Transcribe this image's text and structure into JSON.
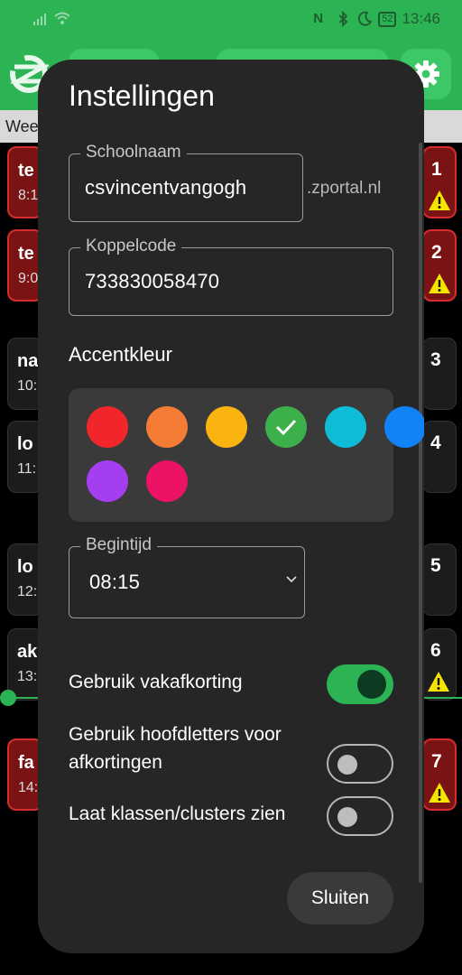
{
  "status_bar": {
    "time": "13:46",
    "battery": "52",
    "icons": [
      "signal-icon",
      "wifi-icon",
      "nfc-icon",
      "bluetooth-icon",
      "moon-icon",
      "battery-icon"
    ]
  },
  "appbar": {
    "week_label": "Wee"
  },
  "background_lessons": [
    {
      "title": "te",
      "time": "8:1",
      "num": "1",
      "warning": true,
      "red": true
    },
    {
      "title": "te",
      "time": "9:0",
      "num": "2",
      "warning": true,
      "red": true
    },
    {
      "title": "na",
      "time": "10:",
      "num": "3",
      "warning": false,
      "red": false
    },
    {
      "title": "lo",
      "time": "11:",
      "num": "4",
      "warning": false,
      "red": false
    },
    {
      "title": "lo",
      "time": "12:",
      "num": "5",
      "warning": false,
      "red": false
    },
    {
      "title": "ak",
      "time": "13:",
      "num": "6",
      "warning": true,
      "red": false
    },
    {
      "title": "fa",
      "time": "14:",
      "num": "7",
      "warning": true,
      "red": true
    }
  ],
  "dialog": {
    "title": "Instellingen",
    "school": {
      "label": "Schoolnaam",
      "value": "csvincentvangogh",
      "suffix": ".zportal.nl"
    },
    "koppelcode": {
      "label": "Koppelcode",
      "value": "733830058470"
    },
    "accent": {
      "label": "Accentkleur",
      "colors": [
        "#f0262a",
        "#f57c35",
        "#fbb40f",
        "#3cb04a",
        "#0fbcd6",
        "#1282f7",
        "#a43ef0",
        "#ec1266"
      ],
      "selected_index": 3
    },
    "begintijd": {
      "label": "Begintijd",
      "value": "08:15"
    },
    "toggles": [
      {
        "label": "Gebruik vakafkorting",
        "on": true
      },
      {
        "label": "Gebruik hoofdletters voor afkortingen",
        "on": false
      },
      {
        "label": "Laat klassen/clusters zien",
        "on": false
      }
    ],
    "close_label": "Sluiten"
  },
  "colors": {
    "primary": "#2bb354",
    "dialog_bg": "#262626",
    "warning": "#f5e400"
  }
}
